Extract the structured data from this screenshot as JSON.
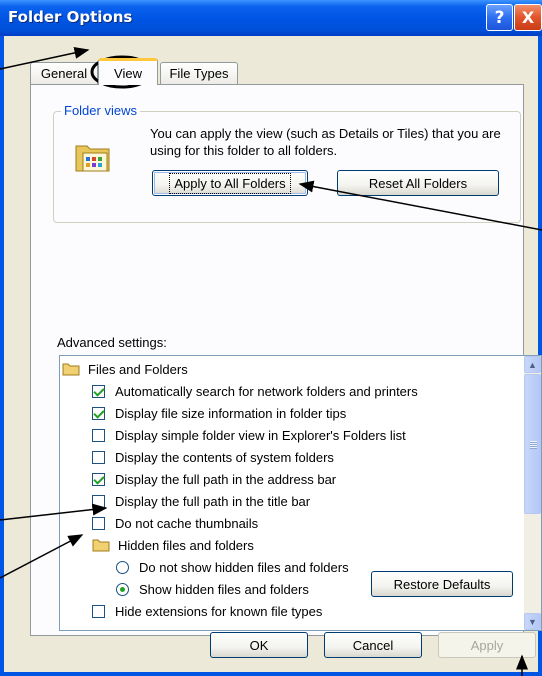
{
  "window": {
    "title": "Folder Options",
    "help_glyph": "?",
    "close_glyph": "X"
  },
  "tabs": [
    {
      "label": "General"
    },
    {
      "label": "View"
    },
    {
      "label": "File Types"
    }
  ],
  "folder_views": {
    "legend": "Folder views",
    "description": "You can apply the view (such as Details or Tiles) that you are using for this folder to all folders.",
    "apply_all_label": "Apply to All Folders",
    "reset_all_label": "Reset All Folders"
  },
  "advanced": {
    "label": "Advanced settings:",
    "items": [
      {
        "type": "folder",
        "label": "Files and Folders"
      },
      {
        "type": "checkbox",
        "checked": true,
        "label": "Automatically search for network folders and printers"
      },
      {
        "type": "checkbox",
        "checked": true,
        "label": "Display file size information in folder tips"
      },
      {
        "type": "checkbox",
        "checked": false,
        "label": "Display simple folder view in Explorer's Folders list"
      },
      {
        "type": "checkbox",
        "checked": false,
        "label": "Display the contents of system folders"
      },
      {
        "type": "checkbox",
        "checked": true,
        "label": "Display the full path in the address bar"
      },
      {
        "type": "checkbox",
        "checked": false,
        "label": "Display the full path in the title bar"
      },
      {
        "type": "checkbox",
        "checked": false,
        "label": "Do not cache thumbnails"
      },
      {
        "type": "folder",
        "label": "Hidden files and folders"
      },
      {
        "type": "radio",
        "checked": false,
        "label": "Do not show hidden files and folders"
      },
      {
        "type": "radio",
        "checked": true,
        "label": "Show hidden files and folders"
      },
      {
        "type": "checkbox",
        "checked": false,
        "label": "Hide extensions for known file types"
      }
    ],
    "restore_label": "Restore Defaults"
  },
  "footer": {
    "ok_label": "OK",
    "cancel_label": "Cancel",
    "apply_label": "Apply"
  },
  "colors": {
    "titlebar": "#0054e3",
    "dialog_bg": "#ece9d8",
    "legend_text": "#0046d5",
    "check_mark": "#21a121"
  }
}
